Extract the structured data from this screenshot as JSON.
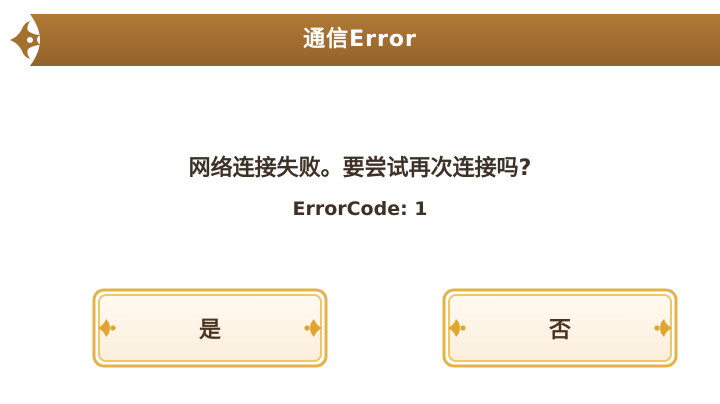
{
  "dialog": {
    "title": "通信Error",
    "message": "网络连接失败。要尝试再次连接吗?",
    "error_code": "ErrorCode: 1"
  },
  "buttons": {
    "yes_label": "是",
    "no_label": "否"
  },
  "colors": {
    "title_bar": "#a3702f",
    "button_border": "#e0a52e",
    "button_fill": "#fff8ec",
    "text": "#3e3226"
  },
  "icons": {
    "title_ornament": "fleur-ornament-icon",
    "button_ornament": "gold-flourish-icon"
  }
}
